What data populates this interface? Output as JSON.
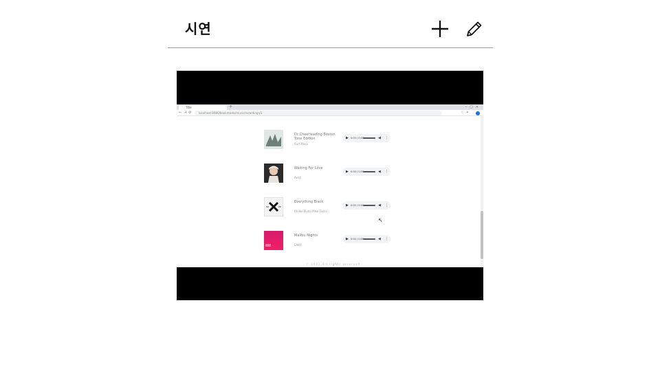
{
  "header": {
    "title": "시연",
    "add_icon": "plus-icon",
    "edit_icon": "pencil-icon"
  },
  "video": {
    "browser": {
      "tab_title": "Title",
      "url": "localhost:8080/bookmarks/music/recordings/1"
    },
    "songs": [
      {
        "title": "Dr Cheerleading Boston Tone Edition",
        "artist": "Surf Mesa",
        "time": "0:00 / 0:00",
        "cover_color": "#b9c7c2"
      },
      {
        "title": "Waiting For Love",
        "artist": "Avicii",
        "time": "0:00 / 0:00",
        "cover_color": "#c8a99a"
      },
      {
        "title": "Everything Black",
        "artist": "Unlike Pluto, Mike Taylor",
        "time": "0:00 / 0:00",
        "cover_color": "#e8e8e8"
      },
      {
        "title": "Malibu Nights",
        "artist": "LANY",
        "time": "0:00 / 0:00",
        "cover_color": "#e0185f"
      }
    ],
    "footer_text": "ⓒ 2021 All rights reserved"
  },
  "colors": {
    "video_background": "#000000",
    "header_rule": "#9a9a9a"
  }
}
